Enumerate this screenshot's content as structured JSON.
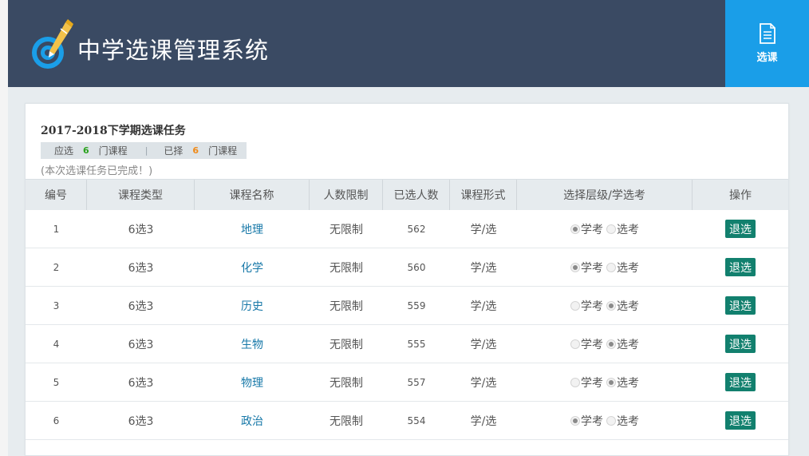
{
  "app": {
    "title": "中学选课管理系统"
  },
  "nav": {
    "select_label": "选课",
    "icon": "document-icon"
  },
  "task": {
    "title": "2017-2018下学期选课任务",
    "required_prefix": "应选",
    "required_count": "6",
    "required_suffix": "门课程",
    "separator": "|",
    "chosen_prefix": "已择",
    "chosen_count": "6",
    "chosen_suffix": "门课程",
    "complete_note": "(本次选课任务已完成！)"
  },
  "table": {
    "headers": [
      "编号",
      "课程类型",
      "课程名称",
      "人数限制",
      "已选人数",
      "课程形式",
      "选择层级/学选考",
      "操作"
    ],
    "rows": [
      {
        "no": "1",
        "type": "6选3",
        "name": "地理",
        "limit": "无限制",
        "enrolled": "562",
        "form": "学/选",
        "opt_a": "学考",
        "opt_b": "选考",
        "selected": "学考",
        "action": "退选"
      },
      {
        "no": "2",
        "type": "6选3",
        "name": "化学",
        "limit": "无限制",
        "enrolled": "560",
        "form": "学/选",
        "opt_a": "学考",
        "opt_b": "选考",
        "selected": "学考",
        "action": "退选"
      },
      {
        "no": "3",
        "type": "6选3",
        "name": "历史",
        "limit": "无限制",
        "enrolled": "559",
        "form": "学/选",
        "opt_a": "学考",
        "opt_b": "选考",
        "selected": "选考",
        "action": "退选"
      },
      {
        "no": "4",
        "type": "6选3",
        "name": "生物",
        "limit": "无限制",
        "enrolled": "555",
        "form": "学/选",
        "opt_a": "学考",
        "opt_b": "选考",
        "selected": "选考",
        "action": "退选"
      },
      {
        "no": "5",
        "type": "6选3",
        "name": "物理",
        "limit": "无限制",
        "enrolled": "557",
        "form": "学/选",
        "opt_a": "学考",
        "opt_b": "选考",
        "selected": "选考",
        "action": "退选"
      },
      {
        "no": "6",
        "type": "6选3",
        "name": "政治",
        "limit": "无限制",
        "enrolled": "554",
        "form": "学/选",
        "opt_a": "学考",
        "opt_b": "选考",
        "selected": "学考",
        "action": "退选"
      }
    ]
  },
  "colors": {
    "header_bg": "#3a4a63",
    "nav_accent": "#1a9ee8",
    "button": "#12806e",
    "link": "#1778a8",
    "required_count": "#2aa21e",
    "chosen_count": "#f08a18"
  }
}
